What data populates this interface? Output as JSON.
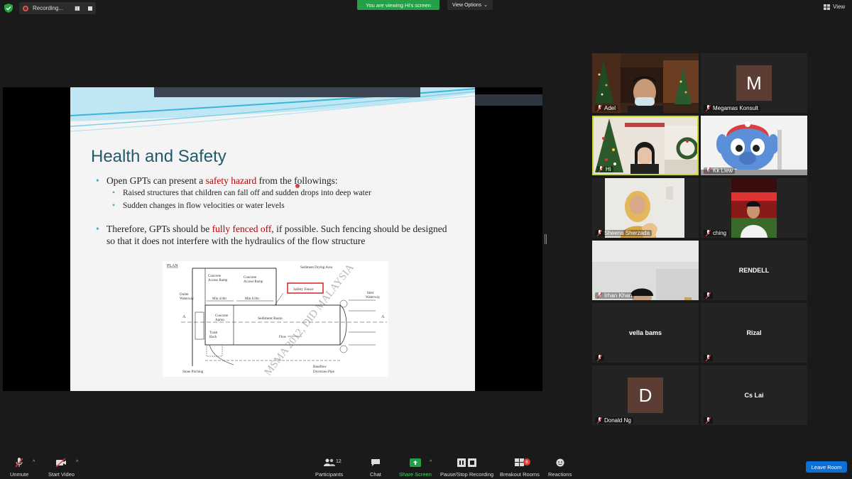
{
  "top": {
    "recording_label": "Recording...",
    "viewing_banner": "You are viewing Hi's screen",
    "view_options_label": "View Options",
    "view_label": "View"
  },
  "slide": {
    "title": "Health and Safety",
    "bullet1_pre": "Open GPTs can present a ",
    "bullet1_red": "safety hazard",
    "bullet1_post": " from the followings:",
    "sub1": "Raised structures that children can fall off and sudden drops into deep water",
    "sub2": "Sudden changes in flow velocities or water levels",
    "bullet2_pre": "Therefore, GPTs should be ",
    "bullet2_red": "fully fenced off",
    "bullet2_post": ", if possible. Such fencing should be designed so that it does not interfere with the hydraulics of the flow structure",
    "diagram": {
      "plan": "PLAN",
      "concrete_access_ramp": "Concrete",
      "access_ramp_2": "Access Ramp",
      "sediment_drying_area": "Sediment Drying Area",
      "outlet": "Outlet",
      "waterway": "Waterway",
      "min4": "Min 4.0m",
      "min6": "Min 6.0m",
      "safety_fence": "Safety Fence",
      "inlet": "Inlet",
      "concrete": "Concrete",
      "apron": "Apron",
      "sediment_basin": "Sediment Basin",
      "trash": "Trash",
      "rack": "Rack",
      "flow": "Flow",
      "stone_pitching": "Stone Pitching",
      "baseflow": "Baseflow",
      "diversion_pipe": "Diversion Pipe",
      "a_left": "A",
      "a_right": "A",
      "watermark": "MSMA 2012, DID MALAYSIA"
    }
  },
  "participants": [
    {
      "name": "Adel"
    },
    {
      "name": "Megamas Konsult",
      "initial": "M"
    },
    {
      "name": "Hi"
    },
    {
      "name": "Kk Liew"
    },
    {
      "name": "Sheena Sherzada"
    },
    {
      "name": "ching"
    },
    {
      "name": "Irhan Khan"
    },
    {
      "name": "RENDELL"
    },
    {
      "name": "vella bams"
    },
    {
      "name": "Rizal"
    },
    {
      "name": "Donald Ng",
      "initial": "D"
    },
    {
      "name": "Cs Lai"
    }
  ],
  "toolbar": {
    "unmute": "Unmute",
    "start_video": "Start Video",
    "participants": "Participants",
    "participants_count": "12",
    "chat": "Chat",
    "share_screen": "Share Screen",
    "pause_stop_recording": "Pause/Stop Recording",
    "breakout_rooms": "Breakout Rooms",
    "breakout_badge": "6",
    "reactions": "Reactions",
    "leave_room": "Leave Room"
  },
  "colors": {
    "viewing_banner": "#24a148",
    "leave_button": "#0b6fd6",
    "slide_title": "#23596b",
    "highlight_red": "#bb0000",
    "active_speaker_border": "#c9d92b"
  }
}
